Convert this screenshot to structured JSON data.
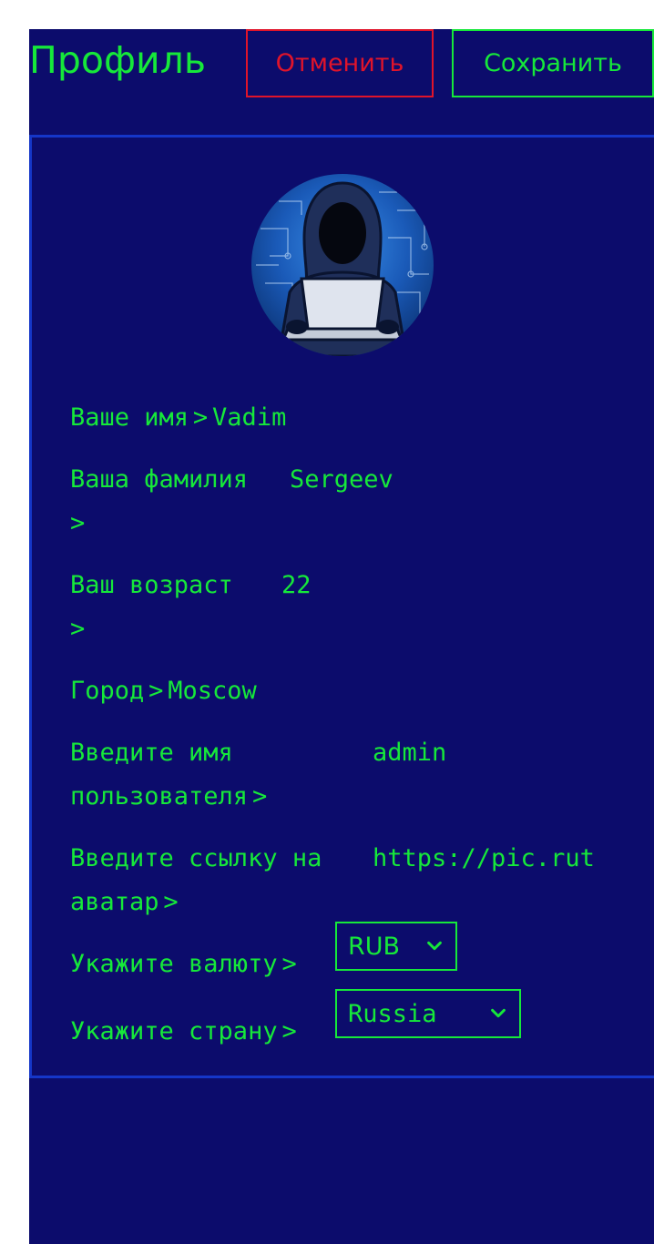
{
  "header": {
    "title": "Профиль",
    "cancel_label": "Отменить",
    "save_label": "Сохранить"
  },
  "profile": {
    "first_name": {
      "label": "Ваше имя",
      "value": "Vadim"
    },
    "last_name": {
      "label": "Ваша фамилия",
      "value": "Sergeev"
    },
    "age": {
      "label": "Ваш возраст",
      "value": "22"
    },
    "city": {
      "label": "Город",
      "value": "Moscow"
    },
    "username": {
      "label_line1": "Введите имя",
      "label_line2": "пользователя",
      "value": "admin"
    },
    "avatar_link": {
      "label_line1": "Введите ссылку на",
      "label_line2": "аватар",
      "value": "https://pic.rut"
    },
    "currency": {
      "label": "Укажите валюту",
      "value": "RUB"
    },
    "country": {
      "label": "Укажите страну",
      "value": "Russia"
    }
  },
  "chevron": ">",
  "colors": {
    "background": "#0c0c6c",
    "accent_green": "#16e83a",
    "cancel_red": "#e0142a",
    "card_border": "#1536c8"
  },
  "icons": {
    "avatar": "hacker-avatar",
    "select_caret": "chevron-down-icon"
  }
}
